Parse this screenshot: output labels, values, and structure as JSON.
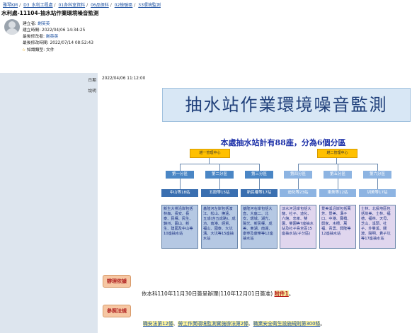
{
  "breadcrumb": [
    "雅琴KM",
    "D3_水利工程處",
    "01各科室資料",
    "06品保科",
    "02檢驗區",
    "33環境監測"
  ],
  "doc": {
    "title": "水利處-11104-抽水站作業環境噪音監測",
    "meta": [
      {
        "label": "建立者",
        "value": "謝英英",
        "link": true
      },
      {
        "label": "建立時間",
        "value": "2022/04/06 14:34:25",
        "link": false
      },
      {
        "label": "最後修改者",
        "value": "謝英英",
        "link": true
      },
      {
        "label": "最後修改時間",
        "value": "2022/07/14 08:52:43",
        "link": false
      }
    ],
    "knowledge_type": "知識類型: 文件"
  },
  "fields": {
    "date_label": "日期",
    "date_value": "2022/04/06 11:12:00",
    "desc_label": "說明"
  },
  "content": {
    "banner": "抽水站作業環境噪音監測",
    "subtitle": "本處抽水站計有88座，分為6個分區",
    "centers": [
      "趙一管理中心",
      "趙二管理中心"
    ],
    "zones": [
      "第一分區",
      "第二分區",
      "第三分區",
      "第四分區",
      "第五分區",
      "第六分區"
    ],
    "counts": [
      "中山等18站",
      "五股等15站",
      "新民權等17站",
      "迪化等23站",
      "東美等12站",
      "圳美等17站"
    ],
    "areas": [
      "新生大排沿岸包括林森、長安、長泰、民權、民生、錦州、圓山、新生、建國及中山等10座抽水站",
      "基隆河左岸包括濱江、松山、撫遠、五成(含五成路)、成功、南港、經貿、福山、國泰、大坑溝、大坑等15座抽水站",
      "基隆河右岸包括大直、大庭二、北安、環城、湖光、陽光、新民權、成美、東湖、南湖、康寧及康樂等12座抽水站",
      "淡水河沿岸包括大龍、社子、迪化、六館、忠孝、雙園、雙園等7座抽水站及社子島全區15座抽水站(子分區)",
      "景美溪沿岸包括萬芳、景美、溝子口、中港、寶橋、興家、木柵、萬福、青雲、興隆等12座抽水站",
      "士林、北投地區包括圳美、士林、福德、福林、天母、芝山、溪頭、社子、外雙溪、關渡、陽明、貴子坑等17座抽水站"
    ],
    "basis_tag": "辦理依據",
    "basis_text": "依本科110年11月30日簽呈辦理(110年12月01日簽准)",
    "attachment": "附件1",
    "basis_end": "。",
    "laws_tag": "參照法規",
    "laws": [
      "職安法第12條",
      "勞工作業環境監測實施辦法第2條",
      "職業安全衛生設施規則第300條"
    ],
    "laws_sep": "、",
    "laws_end": "。"
  }
}
